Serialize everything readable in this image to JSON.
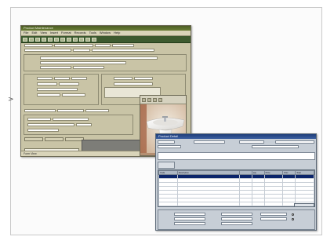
{
  "page": {
    "edge_mark": ">"
  },
  "window_main": {
    "title": "Product Maintenance",
    "menu": [
      "File",
      "Edit",
      "View",
      "Insert",
      "Format",
      "Records",
      "Tools",
      "Window",
      "Help"
    ],
    "status": "Form View",
    "accent_color": "#4b5d24"
  },
  "photo_panel": {
    "subject": "pedestal-washbasin"
  },
  "window_detail": {
    "title": "Product Detail",
    "memo": "",
    "accent_color": "#1e3e7a",
    "table": {
      "headers": [
        "Code",
        "Description",
        "",
        "Qty",
        "Price",
        "Disc",
        "Total"
      ],
      "rows": [
        [
          "",
          "",
          "",
          "",
          "",
          "",
          ""
        ],
        [
          "",
          "",
          "",
          "",
          "",
          "",
          ""
        ],
        [
          "",
          "",
          "",
          "",
          "",
          "",
          ""
        ],
        [
          "",
          "",
          "",
          "",
          "",
          "",
          ""
        ],
        [
          "",
          "",
          "",
          "",
          "",
          "",
          ""
        ],
        [
          "",
          "",
          "",
          "",
          "",
          "",
          ""
        ],
        [
          "",
          "",
          "",
          "",
          "",
          "",
          ""
        ],
        [
          "",
          "",
          "",
          "",
          "",
          "",
          ""
        ]
      ],
      "selected_row": 0
    }
  }
}
